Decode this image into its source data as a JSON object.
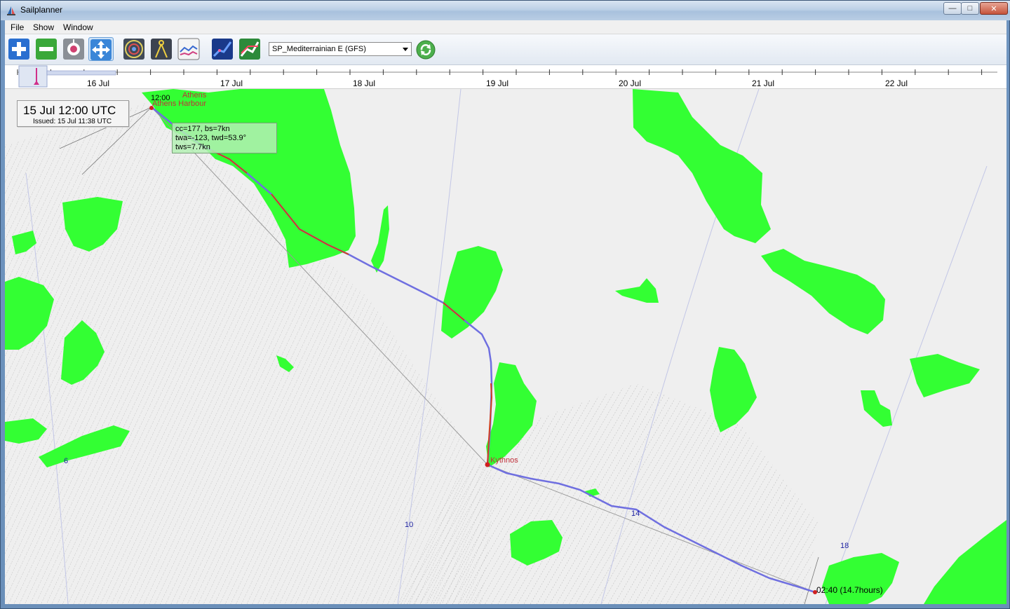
{
  "window": {
    "title": "Sailplanner"
  },
  "menu": [
    "File",
    "Show",
    "Window"
  ],
  "toolbar": {
    "model_select": "SP_Mediterrainian E (GFS)",
    "buttons": [
      "zoom-in",
      "zoom-out",
      "location",
      "pan",
      "wind-rose",
      "compass-divider",
      "chart",
      "route-graph",
      "route-compare"
    ]
  },
  "timeline": {
    "labels": [
      "16 Jul",
      "17 Jul",
      "18 Jul",
      "19 Jul",
      "20 Jul",
      "21 Jul",
      "22 Jul"
    ]
  },
  "map": {
    "time_box": {
      "main": "15 Jul 12:00 UTC",
      "issued": "Issued: 15 Jul 11:38 UTC"
    },
    "info_box": {
      "line1": "cc=177,  bs=7kn",
      "line2": "twa=-123, twd=53.9°",
      "line3": "tws=7.7kn"
    },
    "labels": {
      "start_time": "12:00",
      "start_city": "Athens",
      "start_place": "Athens Harbour",
      "waypoint": "Kythnos",
      "end_time": "02:40 (14.7hours)",
      "isobar_6": "6",
      "isobar_10": "10",
      "isobar_14": "14",
      "isobar_18": "18"
    }
  },
  "colors": {
    "land": "#33ff33",
    "sea": "#efefef",
    "route": "#6f6fe0",
    "route_motor": "#d04020",
    "label_red": "#c0303a",
    "label_blue": "#1a1fa0"
  }
}
